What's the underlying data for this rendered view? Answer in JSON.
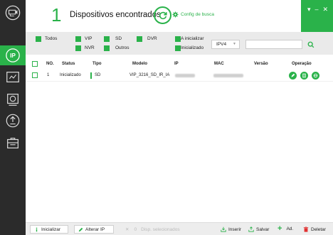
{
  "header": {
    "count": "1",
    "title": "Dispositivos encontrados",
    "config_link": "Config de busca",
    "window_controls": [
      "▾",
      "–",
      "✕"
    ]
  },
  "filters": {
    "todos": "Todos",
    "vip": "VIP",
    "sd": "SD",
    "dvr": "DVR",
    "nvr": "NVR",
    "outros": "Outros",
    "a_inicializar": "A inicializar",
    "inicializado": "Inicializado",
    "ip_version": "IPV4",
    "search_placeholder": ""
  },
  "table": {
    "columns": [
      "NO.",
      "Status",
      "Tipo",
      "Modelo",
      "IP",
      "MAC",
      "Versão",
      "Operação"
    ],
    "rows": [
      {
        "no": "1",
        "status": "Inicializado",
        "tipo": "SD",
        "modelo": "VIP_3216_SD_IR_IA",
        "ip": "",
        "mac": "",
        "versao": ""
      }
    ]
  },
  "bottom": {
    "inicializar": "Inicializar",
    "alterar_ip": "Alterar IP",
    "selected_count": "0",
    "selected_label": "Disp. selecionados",
    "inserir": "Inserir",
    "salvar": "Salvar",
    "add": "Ad.",
    "deletar": "Deletar"
  },
  "colors": {
    "accent": "#2ab24a",
    "sidebar": "#2b2b2b",
    "delete": "#e03030"
  },
  "icons": [
    "camera-icon",
    "ip-icon",
    "upgrade-icon",
    "settings-icon",
    "config-wheel-icon",
    "reset-icon",
    "toolbox-icon"
  ]
}
